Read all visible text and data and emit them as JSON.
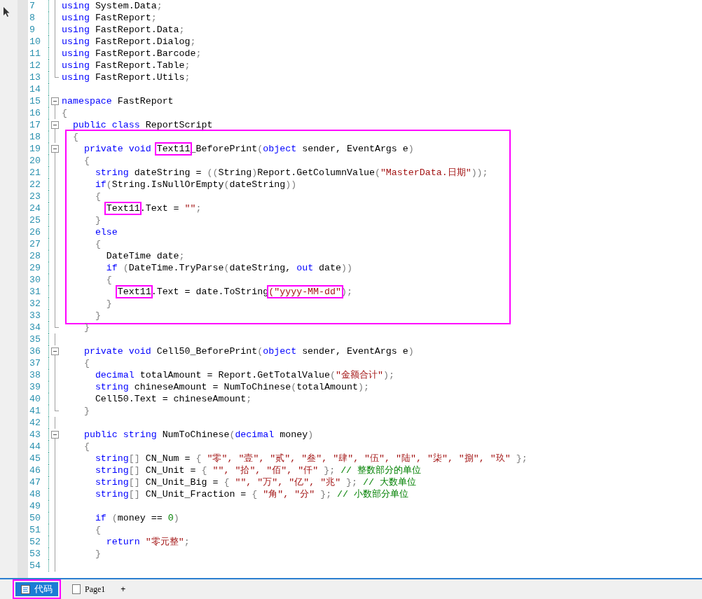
{
  "editor": {
    "blocks": [
      {
        "outlined": false,
        "lines": [
          {
            "number": "7",
            "kind": "guide",
            "segments": [
              {
                "kind": "keyword",
                "text": "using"
              },
              {
                "kind": "plain",
                "text": " System.Data"
              },
              {
                "kind": "punct",
                "text": ";"
              }
            ]
          },
          {
            "number": "8",
            "kind": "guide",
            "segments": [
              {
                "kind": "keyword",
                "text": "using"
              },
              {
                "kind": "plain",
                "text": " FastReport"
              },
              {
                "kind": "punct",
                "text": ";"
              }
            ]
          },
          {
            "number": "9",
            "kind": "guide",
            "segments": [
              {
                "kind": "keyword",
                "text": "using"
              },
              {
                "kind": "plain",
                "text": " FastReport.Data"
              },
              {
                "kind": "punct",
                "text": ";"
              }
            ]
          },
          {
            "number": "10",
            "kind": "guide",
            "segments": [
              {
                "kind": "keyword",
                "text": "using"
              },
              {
                "kind": "plain",
                "text": " FastReport.Dialog"
              },
              {
                "kind": "punct",
                "text": ";"
              }
            ]
          },
          {
            "number": "11",
            "kind": "guide",
            "segments": [
              {
                "kind": "keyword",
                "text": "using"
              },
              {
                "kind": "plain",
                "text": " FastReport.Barcode"
              },
              {
                "kind": "punct",
                "text": ";"
              }
            ]
          },
          {
            "number": "12",
            "kind": "guide",
            "segments": [
              {
                "kind": "keyword",
                "text": "using"
              },
              {
                "kind": "plain",
                "text": " FastReport.Table"
              },
              {
                "kind": "punct",
                "text": ";"
              }
            ]
          },
          {
            "number": "13",
            "kind": "end",
            "segments": [
              {
                "kind": "keyword",
                "text": "using"
              },
              {
                "kind": "plain",
                "text": " FastReport.Utils"
              },
              {
                "kind": "punct",
                "text": ";"
              }
            ]
          },
          {
            "number": "14",
            "kind": "blank"
          },
          {
            "number": "15",
            "kind": "start",
            "segments": [
              {
                "kind": "keyword",
                "text": "namespace"
              },
              {
                "kind": "plain",
                "text": " FastReport"
              }
            ]
          },
          {
            "number": "16",
            "kind": "guide",
            "segments": [
              {
                "kind": "punct",
                "text": "{"
              }
            ]
          },
          {
            "number": "17",
            "kind": "start",
            "segments": [
              {
                "kind": "keyword",
                "text": "  public class"
              },
              {
                "kind": "plain",
                "text": " ReportScript"
              }
            ]
          }
        ]
      },
      {
        "outlined": true,
        "lines": [
          {
            "number": "18",
            "kind": "guide",
            "segments": [
              {
                "kind": "punct",
                "text": "  {"
              }
            ]
          },
          {
            "number": "19",
            "kind": "start",
            "segments": [
              {
                "kind": "keyword",
                "text": "    private void "
              },
              {
                "kind": "plain",
                "text": "Text11",
                "outlined": true
              },
              {
                "kind": "plain",
                "text": "_BeforePrint"
              },
              {
                "kind": "punct",
                "text": "("
              },
              {
                "kind": "keyword",
                "text": "object"
              },
              {
                "kind": "plain",
                "text": " sender, EventArgs e"
              },
              {
                "kind": "punct",
                "text": ")"
              }
            ]
          },
          {
            "number": "20",
            "kind": "guide",
            "segments": [
              {
                "kind": "punct",
                "text": "    {"
              }
            ]
          },
          {
            "number": "21",
            "kind": "guide",
            "segments": [
              {
                "kind": "keyword",
                "text": "      string"
              },
              {
                "kind": "plain",
                "text": " dateString = "
              },
              {
                "kind": "punct",
                "text": "(("
              },
              {
                "kind": "plain",
                "text": "String"
              },
              {
                "kind": "punct",
                "text": ")"
              },
              {
                "kind": "plain",
                "text": "Report.GetColumnValue"
              },
              {
                "kind": "punct",
                "text": "("
              },
              {
                "kind": "string",
                "text": "\"MasterData.日期\""
              },
              {
                "kind": "punct",
                "text": "));"
              }
            ]
          },
          {
            "number": "22",
            "kind": "guide",
            "segments": [
              {
                "kind": "keyword",
                "text": "      if"
              },
              {
                "kind": "punct",
                "text": "("
              },
              {
                "kind": "plain",
                "text": "String.IsNullOrEmpty"
              },
              {
                "kind": "punct",
                "text": "("
              },
              {
                "kind": "plain",
                "text": "dateString"
              },
              {
                "kind": "punct",
                "text": "))"
              }
            ]
          },
          {
            "number": "23",
            "kind": "guide",
            "segments": [
              {
                "kind": "punct",
                "text": "      {"
              }
            ]
          },
          {
            "number": "24",
            "kind": "guide",
            "segments": [
              {
                "kind": "plain",
                "text": "        Text11",
                "outlined": true
              },
              {
                "kind": "plain",
                "text": ".Text = "
              },
              {
                "kind": "string",
                "text": "\"\""
              },
              {
                "kind": "punct",
                "text": ";"
              }
            ]
          },
          {
            "number": "25",
            "kind": "guide",
            "segments": [
              {
                "kind": "punct",
                "text": "      }"
              }
            ]
          },
          {
            "number": "26",
            "kind": "guide",
            "segments": [
              {
                "kind": "keyword",
                "text": "      else"
              }
            ]
          },
          {
            "number": "27",
            "kind": "guide",
            "segments": [
              {
                "kind": "punct",
                "text": "      {"
              }
            ]
          },
          {
            "number": "28",
            "kind": "guide",
            "segments": [
              {
                "kind": "plain",
                "text": "        DateTime date"
              },
              {
                "kind": "punct",
                "text": ";"
              }
            ]
          },
          {
            "number": "29",
            "kind": "guide",
            "segments": [
              {
                "kind": "keyword",
                "text": "        if "
              },
              {
                "kind": "punct",
                "text": "("
              },
              {
                "kind": "plain",
                "text": "DateTime.TryParse"
              },
              {
                "kind": "punct",
                "text": "("
              },
              {
                "kind": "plain",
                "text": "dateString, "
              },
              {
                "kind": "keyword",
                "text": "out"
              },
              {
                "kind": "plain",
                "text": " date"
              },
              {
                "kind": "punct",
                "text": "))"
              }
            ]
          },
          {
            "number": "30",
            "kind": "guide",
            "segments": [
              {
                "kind": "punct",
                "text": "        {"
              }
            ]
          },
          {
            "number": "31",
            "kind": "guide",
            "segments": [
              {
                "kind": "plain",
                "text": "          Text11",
                "outlined": true
              },
              {
                "kind": "plain",
                "text": ".Text = date.ToString"
              },
              {
                "kind": "string",
                "text": "(\"yyyy-MM-dd\"",
                "outlined": true
              },
              {
                "kind": "punct",
                "text": ");"
              }
            ]
          },
          {
            "number": "32",
            "kind": "guide",
            "segments": [
              {
                "kind": "punct",
                "text": "        }"
              }
            ]
          },
          {
            "number": "33",
            "kind": "guide",
            "segments": [
              {
                "kind": "punct",
                "text": "      }"
              }
            ]
          }
        ]
      },
      {
        "outlined": false,
        "lines": [
          {
            "number": "34",
            "kind": "end",
            "segments": [
              {
                "kind": "punct",
                "text": "    }"
              }
            ]
          },
          {
            "number": "35",
            "kind": "guide"
          },
          {
            "number": "36",
            "kind": "start",
            "segments": [
              {
                "kind": "keyword",
                "text": "    private void"
              },
              {
                "kind": "plain",
                "text": " Cell50_BeforePrint"
              },
              {
                "kind": "punct",
                "text": "("
              },
              {
                "kind": "keyword",
                "text": "object"
              },
              {
                "kind": "plain",
                "text": " sender, EventArgs e"
              },
              {
                "kind": "punct",
                "text": ")"
              }
            ]
          },
          {
            "number": "37",
            "kind": "guide",
            "segments": [
              {
                "kind": "punct",
                "text": "    {"
              }
            ]
          },
          {
            "number": "38",
            "kind": "guide",
            "segments": [
              {
                "kind": "keyword",
                "text": "      decimal"
              },
              {
                "kind": "plain",
                "text": " totalAmount = Report.GetTotalValue"
              },
              {
                "kind": "punct",
                "text": "("
              },
              {
                "kind": "string",
                "text": "\"金额合计\""
              },
              {
                "kind": "punct",
                "text": ");"
              }
            ]
          },
          {
            "number": "39",
            "kind": "guide",
            "segments": [
              {
                "kind": "keyword",
                "text": "      string"
              },
              {
                "kind": "plain",
                "text": " chineseAmount = NumToChinese"
              },
              {
                "kind": "punct",
                "text": "("
              },
              {
                "kind": "plain",
                "text": "totalAmount"
              },
              {
                "kind": "punct",
                "text": ");"
              }
            ]
          },
          {
            "number": "40",
            "kind": "guide",
            "segments": [
              {
                "kind": "plain",
                "text": "      Cell50.Text = chineseAmount"
              },
              {
                "kind": "punct",
                "text": ";"
              }
            ]
          },
          {
            "number": "41",
            "kind": "end",
            "segments": [
              {
                "kind": "punct",
                "text": "    }"
              }
            ]
          },
          {
            "number": "42",
            "kind": "guide"
          },
          {
            "number": "43",
            "kind": "start",
            "segments": [
              {
                "kind": "keyword",
                "text": "    public string"
              },
              {
                "kind": "plain",
                "text": " NumToChinese"
              },
              {
                "kind": "punct",
                "text": "("
              },
              {
                "kind": "keyword",
                "text": "decimal"
              },
              {
                "kind": "plain",
                "text": " money"
              },
              {
                "kind": "punct",
                "text": ")"
              }
            ]
          },
          {
            "number": "44",
            "kind": "guide",
            "segments": [
              {
                "kind": "punct",
                "text": "    {"
              }
            ]
          },
          {
            "number": "45",
            "kind": "guide",
            "segments": [
              {
                "kind": "keyword",
                "text": "      string"
              },
              {
                "kind": "punct",
                "text": "[]"
              },
              {
                "kind": "plain",
                "text": " CN_Num = "
              },
              {
                "kind": "punct",
                "text": "{ "
              },
              {
                "kind": "string",
                "text": "\"零\", \"壹\", \"贰\", \"叁\", \"肆\", \"伍\", \"陆\", \"柒\", \"捌\", \"玖\""
              },
              {
                "kind": "punct",
                "text": " };"
              }
            ]
          },
          {
            "number": "46",
            "kind": "guide",
            "segments": [
              {
                "kind": "keyword",
                "text": "      string"
              },
              {
                "kind": "punct",
                "text": "[]"
              },
              {
                "kind": "plain",
                "text": " CN_Unit = "
              },
              {
                "kind": "punct",
                "text": "{ "
              },
              {
                "kind": "string",
                "text": "\"\", \"拾\", \"佰\", \"仟\""
              },
              {
                "kind": "punct",
                "text": " };"
              },
              {
                "kind": "comment",
                "text": " // 整数部分的单位"
              }
            ]
          },
          {
            "number": "47",
            "kind": "guide",
            "segments": [
              {
                "kind": "keyword",
                "text": "      string"
              },
              {
                "kind": "punct",
                "text": "[]"
              },
              {
                "kind": "plain",
                "text": " CN_Unit_Big = "
              },
              {
                "kind": "punct",
                "text": "{ "
              },
              {
                "kind": "string",
                "text": "\"\", \"万\", \"亿\", \"兆\""
              },
              {
                "kind": "punct",
                "text": " };"
              },
              {
                "kind": "comment",
                "text": " // 大数单位"
              }
            ]
          },
          {
            "number": "48",
            "kind": "guide",
            "segments": [
              {
                "kind": "keyword",
                "text": "      string"
              },
              {
                "kind": "punct",
                "text": "[]"
              },
              {
                "kind": "plain",
                "text": " CN_Unit_Fraction = "
              },
              {
                "kind": "punct",
                "text": "{ "
              },
              {
                "kind": "string",
                "text": "\"角\", \"分\""
              },
              {
                "kind": "punct",
                "text": " };"
              },
              {
                "kind": "comment",
                "text": " // 小数部分单位"
              }
            ]
          },
          {
            "number": "49",
            "kind": "guide"
          },
          {
            "number": "50",
            "kind": "guide",
            "segments": [
              {
                "kind": "keyword",
                "text": "      if "
              },
              {
                "kind": "punct",
                "text": "("
              },
              {
                "kind": "plain",
                "text": "money == "
              },
              {
                "kind": "number",
                "text": "0"
              },
              {
                "kind": "punct",
                "text": ")"
              }
            ]
          },
          {
            "number": "51",
            "kind": "guide",
            "segments": [
              {
                "kind": "punct",
                "text": "      {"
              }
            ]
          },
          {
            "number": "52",
            "kind": "guide",
            "segments": [
              {
                "kind": "keyword",
                "text": "        return "
              },
              {
                "kind": "string",
                "text": "\"零元整\""
              },
              {
                "kind": "punct",
                "text": ";"
              }
            ]
          },
          {
            "number": "53",
            "kind": "guide",
            "segments": [
              {
                "kind": "punct",
                "text": "      }"
              }
            ]
          },
          {
            "number": "54",
            "kind": "guide"
          }
        ]
      }
    ]
  },
  "tabs": [
    {
      "label": "代码",
      "kind": "code",
      "selected": true,
      "outlined": true
    },
    {
      "label": "Page1",
      "kind": "page",
      "selected": false,
      "outlined": false
    }
  ],
  "add_tab": {
    "label": "+"
  }
}
